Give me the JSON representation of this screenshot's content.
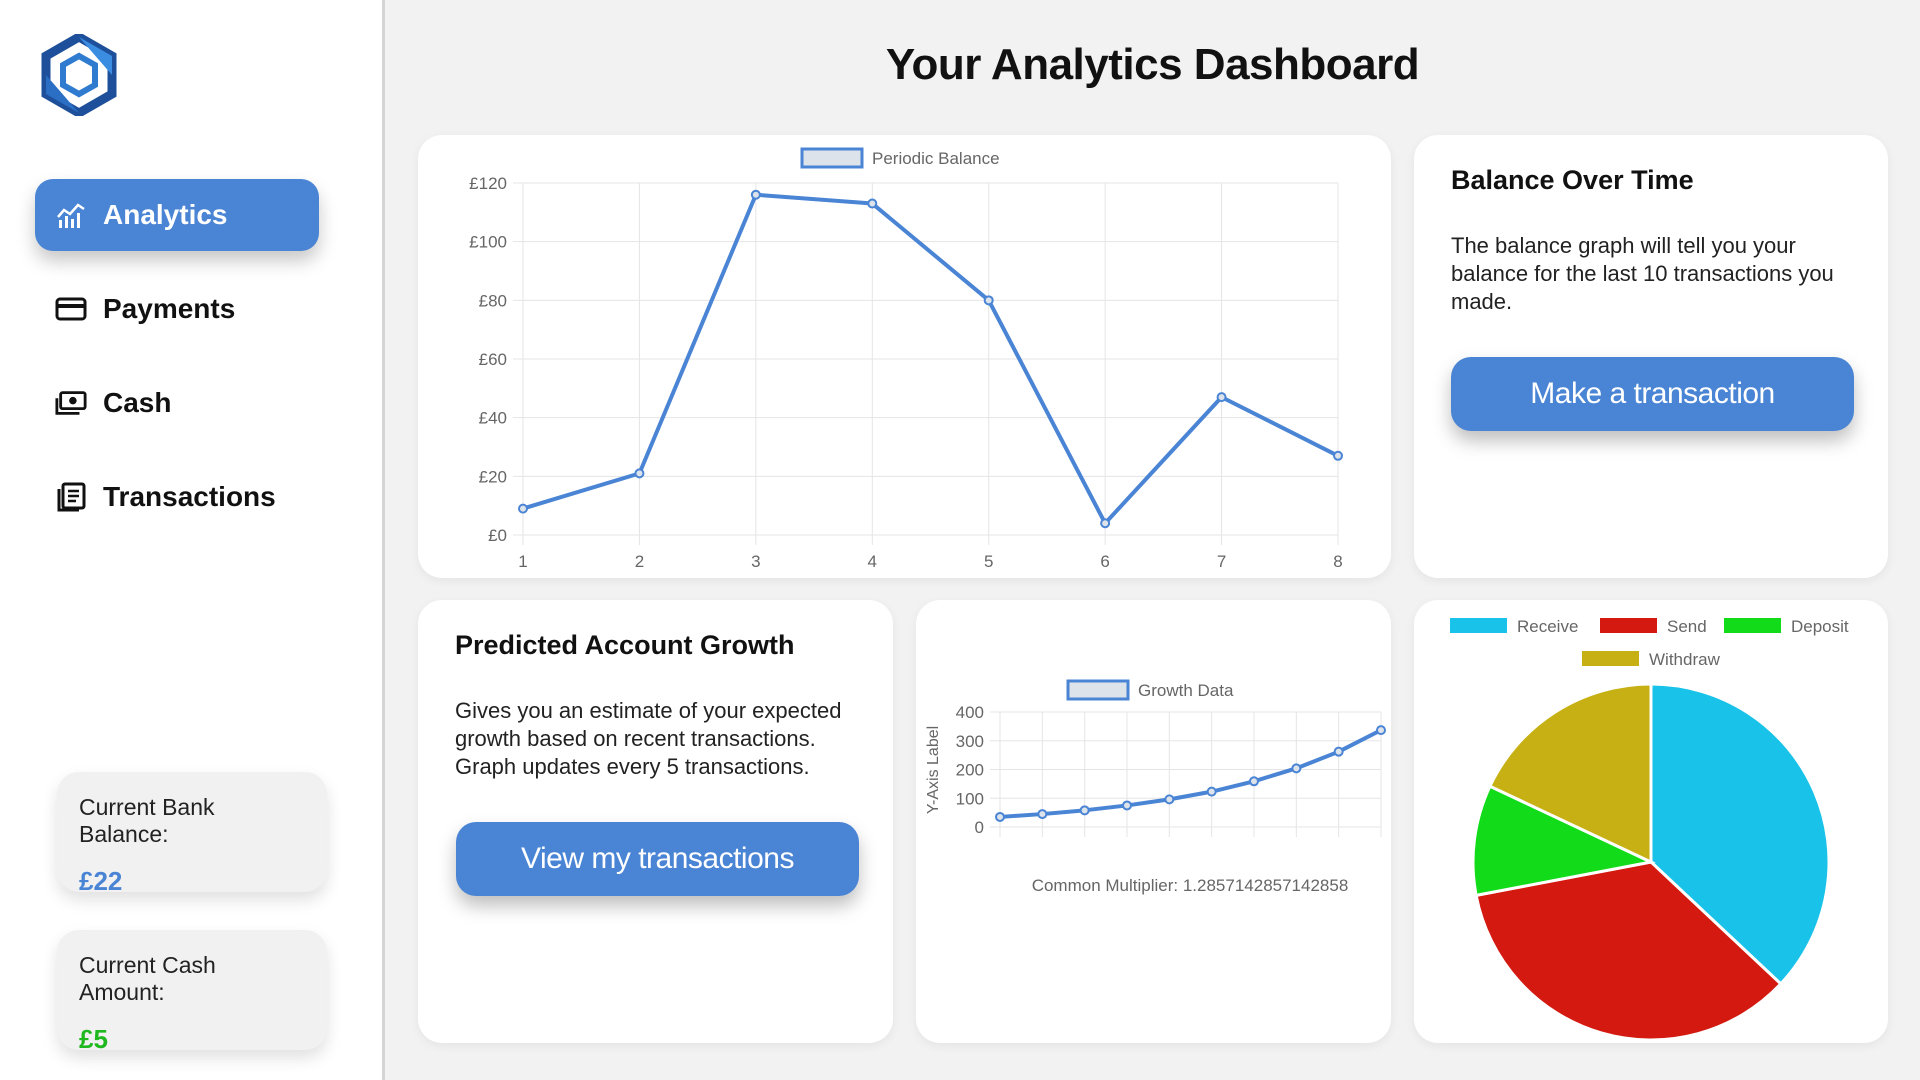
{
  "sidebar": {
    "nav": [
      {
        "label": "Analytics",
        "icon": "analytics-chart-icon",
        "active": true
      },
      {
        "label": "Payments",
        "icon": "credit-card-icon",
        "active": false
      },
      {
        "label": "Cash",
        "icon": "cash-icon",
        "active": false
      },
      {
        "label": "Transactions",
        "icon": "receipt-list-icon",
        "active": false
      }
    ],
    "bank_balance": {
      "label": "Current Bank Balance:",
      "value": "£22"
    },
    "cash_amount": {
      "label": "Current Cash Amount:",
      "value": "£5"
    }
  },
  "header": {
    "title": "Your Analytics Dashboard"
  },
  "balance_info": {
    "title": "Balance Over Time",
    "text": "The balance graph will tell you your balance for the last 10 transactions you made.",
    "button": "Make a transaction"
  },
  "growth_info": {
    "title": "Predicted Account Growth",
    "text": "Gives you an estimate of your expected growth based on recent transactions. Graph updates every 5 transactions.",
    "button": "View my transactions"
  },
  "colors": {
    "accent": "#4a84d4",
    "balance_value": "#4a84d4",
    "cash_value": "#1fb81f",
    "receive": "#19c2e8",
    "send": "#d41a10",
    "deposit": "#12dc1a",
    "withdraw": "#c6b013"
  },
  "chart_data": [
    {
      "type": "line",
      "legend": "Periodic Balance",
      "x": [
        1,
        2,
        3,
        4,
        5,
        6,
        7,
        8
      ],
      "y": [
        9,
        21,
        116,
        113,
        80,
        4,
        47,
        27
      ],
      "yticks": [
        "£0",
        "£20",
        "£40",
        "£60",
        "£80",
        "£100",
        "£120"
      ],
      "ylim": [
        0,
        120
      ],
      "grid": true
    },
    {
      "type": "line",
      "legend": "Growth Data",
      "ylabel": "Y-Axis Label",
      "x": [
        1,
        2,
        3,
        4,
        5,
        6,
        7,
        8,
        9,
        10
      ],
      "y": [
        35,
        45,
        58,
        75,
        96,
        123,
        159,
        204,
        262,
        337
      ],
      "yticks": [
        "0",
        "100",
        "200",
        "300",
        "400"
      ],
      "ylim": [
        0,
        400
      ],
      "annotation": "Common Multiplier: 1.2857142857142858",
      "grid": true
    },
    {
      "type": "pie",
      "labels": [
        "Receive",
        "Send",
        "Deposit",
        "Withdraw"
      ],
      "values": [
        37,
        35,
        10,
        18
      ],
      "legend_position": "top"
    }
  ]
}
